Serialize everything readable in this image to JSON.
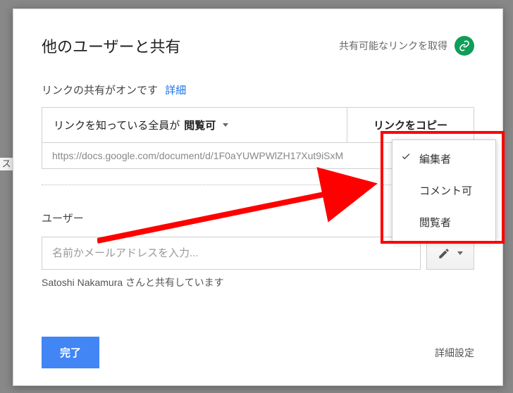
{
  "header": {
    "title": "他のユーザーと共有",
    "get_link_label": "共有可能なリンクを取得"
  },
  "link_sharing": {
    "status_text": "リンクの共有がオンです",
    "detail_link": "詳細",
    "access_prefix": "リンクを知っている全員が",
    "access_bold": "閲覧可",
    "copy_label": "リンクをコピー",
    "url": "https://docs.google.com/document/d/1F0aYUWPWlZH17Xut9iSxM"
  },
  "users": {
    "label": "ユーザー",
    "placeholder": "名前かメールアドレスを入力...",
    "shared_with": "Satoshi Nakamura さんと共有しています"
  },
  "footer": {
    "done": "完了",
    "advanced": "詳細設定"
  },
  "dropdown": {
    "items": [
      "編集者",
      "コメント可",
      "閲覧者"
    ],
    "selected": 0
  },
  "left_sliver": "ス"
}
